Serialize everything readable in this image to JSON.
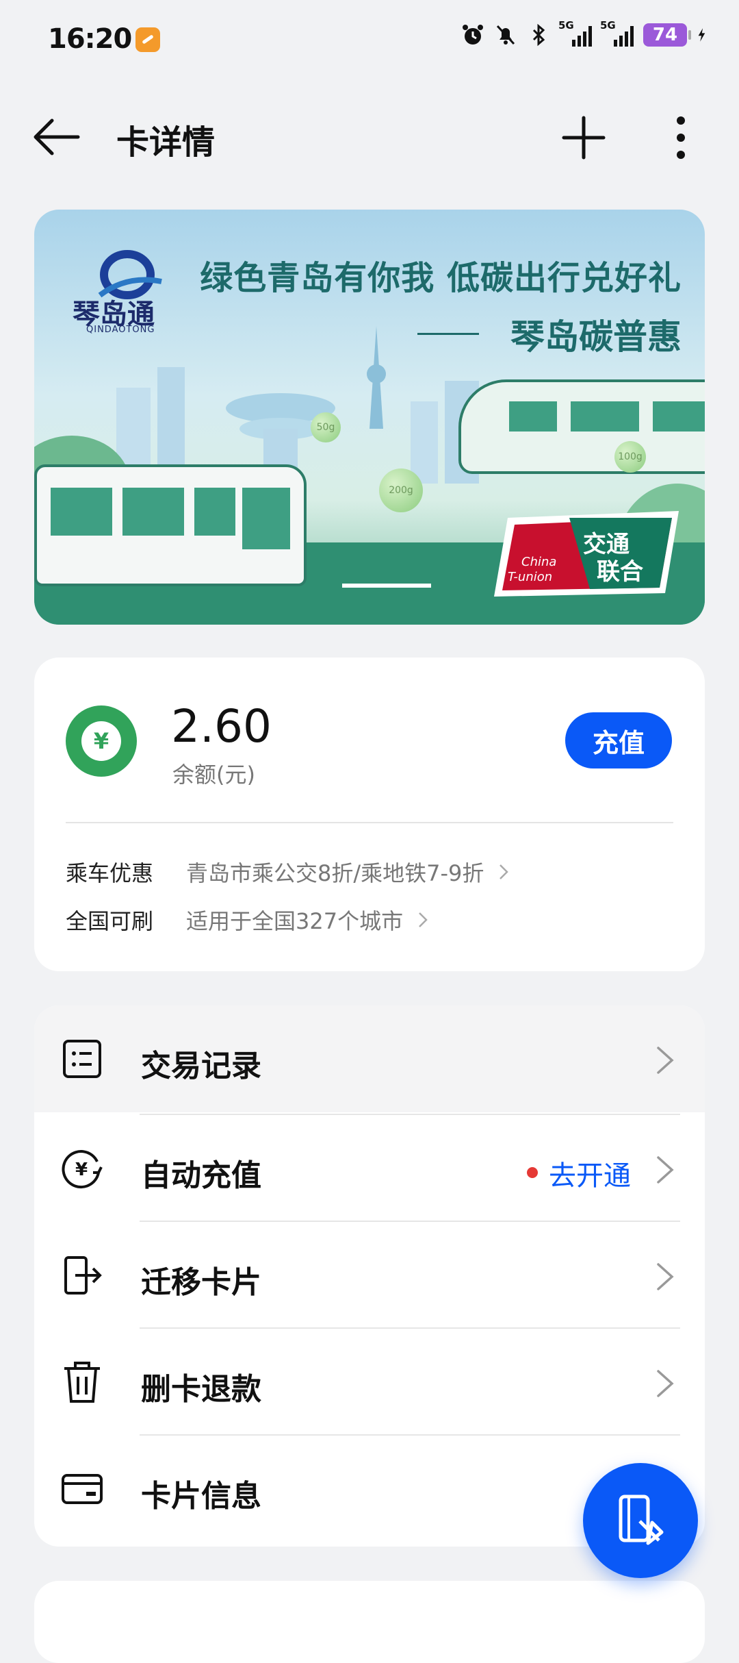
{
  "status_bar": {
    "time": "16:20",
    "signal1_label": "5G",
    "signal2_label": "5G",
    "battery": "74"
  },
  "header": {
    "title": "卡详情",
    "back_icon": "back-arrow-icon",
    "add_icon": "plus-icon",
    "more_icon": "more-vertical-icon"
  },
  "card": {
    "logo_text": "琴岛通",
    "logo_sub": "QINDAOTONG",
    "slogan_line1": "绿色青岛有你我 低碳出行兑好礼",
    "slogan_line2": "琴岛碳普惠",
    "bubble_1": "50g",
    "bubble_2": "200g",
    "bubble_3": "100g",
    "tunion_cn": "交通联合",
    "tunion_en": "China T-union"
  },
  "balance": {
    "amount": "2.60",
    "label": "余额(元)",
    "topup_button": "充值",
    "discount_key": "乘车优惠",
    "discount_value": "青岛市乘公交8折/乘地铁7-9折",
    "nationwide_key": "全国可刷",
    "nationwide_value": "适用于全国327个城市"
  },
  "menu": {
    "items": [
      {
        "label": "交易记录",
        "icon": "list-icon"
      },
      {
        "label": "自动充值",
        "icon": "auto-recharge-icon",
        "action": "去开通"
      },
      {
        "label": "迁移卡片",
        "icon": "transfer-card-icon"
      },
      {
        "label": "删卡退款",
        "icon": "trash-icon"
      },
      {
        "label": "卡片信息",
        "icon": "card-info-icon"
      }
    ]
  },
  "fab_icon": "nfc-card-icon",
  "colors": {
    "accent": "#0a59f7",
    "balance_badge": "#31a35a",
    "background": "#f1f2f4"
  }
}
